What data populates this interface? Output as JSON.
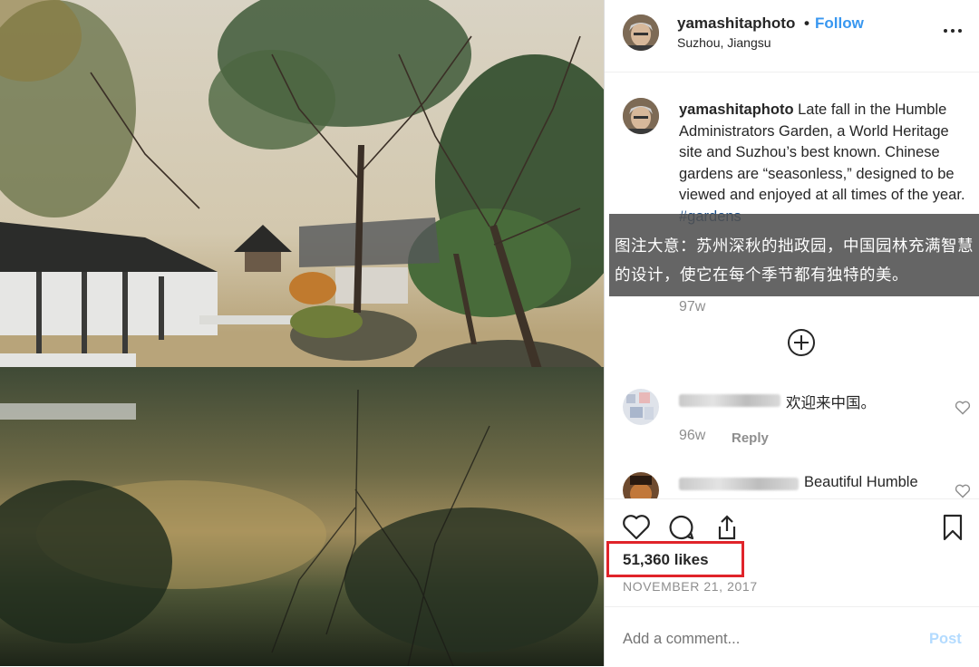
{
  "colors": {
    "accent": "#3897f0",
    "hashtag": "#1b4f8a",
    "highlight_box": "#e0242a",
    "muted": "#8e8e8e",
    "post_disabled": "#b3dbff"
  },
  "header": {
    "username": "yamashitaphoto",
    "separator": "•",
    "follow_label": "Follow",
    "location": "Suzhou, Jiangsu",
    "more_icon": "ellipsis-icon"
  },
  "caption": {
    "username": "yamashitaphoto",
    "text": "Late fall in the Humble Administrators Garden, a World Heritage site and Suzhou’s best known. Chinese gardens are “seasonless,” designed to be viewed and enjoyed at all times of the year. ",
    "hashtag": "#gardens",
    "age": "97w"
  },
  "translation_overlay": {
    "text": "图注大意：苏州深秋的拙政园，中国园林充满智慧的设计，使它在每个季节都有独特的美。"
  },
  "load_more_icon": "plus-circle-icon",
  "comments": [
    {
      "text": "欢迎来中国。",
      "age": "96w",
      "reply_label": "Reply"
    },
    {
      "text": "Beautiful Humble"
    }
  ],
  "actions": {
    "icons": [
      "heart-icon",
      "comment-icon",
      "share-icon",
      "bookmark-icon"
    ],
    "likes": "51,360 likes",
    "date": "NOVEMBER 21, 2017"
  },
  "comment_box": {
    "placeholder": "Add a comment...",
    "post_label": "Post"
  }
}
